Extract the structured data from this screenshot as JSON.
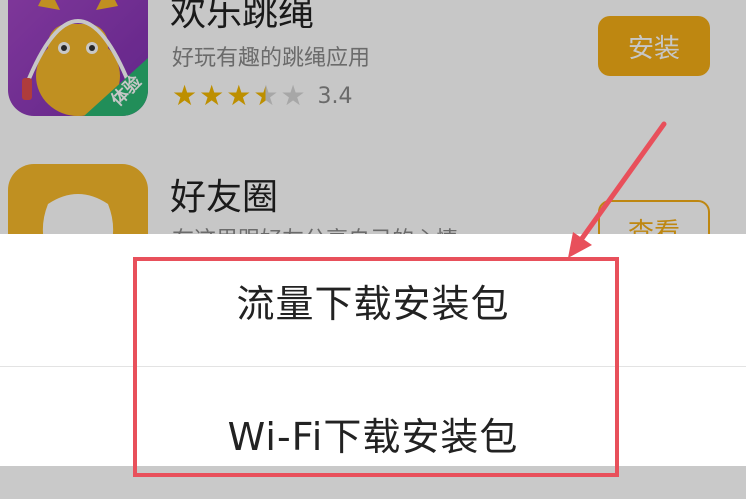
{
  "apps": [
    {
      "name": "欢乐跳绳",
      "description": "好玩有趣的跳绳应用",
      "badge": "体验",
      "rating": 3.4,
      "rating_text": "3.4",
      "stars": [
        "full",
        "full",
        "full",
        "half",
        "empty"
      ],
      "button_label": "安装"
    },
    {
      "name": "好友圈",
      "description": "在这里跟好友分享自己的心情",
      "button_label": "查看"
    }
  ],
  "sheet": {
    "options": [
      "流量下载安装包",
      "Wi-Fi下载安装包"
    ]
  },
  "colors": {
    "accent": "#f4ad16",
    "annotation": "#e8505b",
    "badge": "#2bb673"
  },
  "icons": {
    "app1": "skipping-rope-app-icon",
    "app2": "friends-circle-app-icon",
    "annotation_arrow": "red-arrow"
  }
}
